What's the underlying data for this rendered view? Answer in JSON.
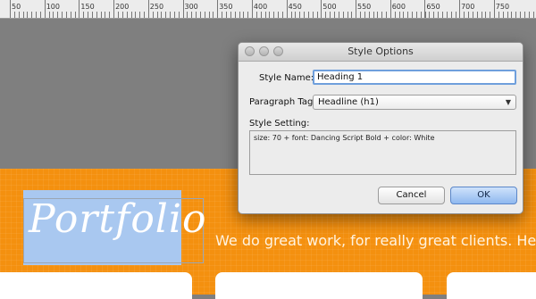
{
  "ruler": {
    "labels": [
      "50",
      "100",
      "150",
      "200",
      "250",
      "300",
      "350",
      "400",
      "450",
      "500",
      "550",
      "600",
      "650",
      "700",
      "750"
    ]
  },
  "canvas": {
    "heading_text": "Portfolio",
    "tagline": "We do great work, for really great clients.  Here's"
  },
  "dialog": {
    "title": "Style Options",
    "style_name_label": "Style Name:",
    "style_name_value": "Heading 1",
    "paragraph_tag_label": "Paragraph Tag:",
    "paragraph_tag_value": "Headline (h1)",
    "style_setting_label": "Style Setting:",
    "style_setting_value": "size: 70 + font: Dancing Script Bold + color: White",
    "cancel_label": "Cancel",
    "ok_label": "OK"
  },
  "colors": {
    "band": "#f4900f",
    "selection": "#a9c8f0",
    "ok_button": "#8fb8ef"
  }
}
